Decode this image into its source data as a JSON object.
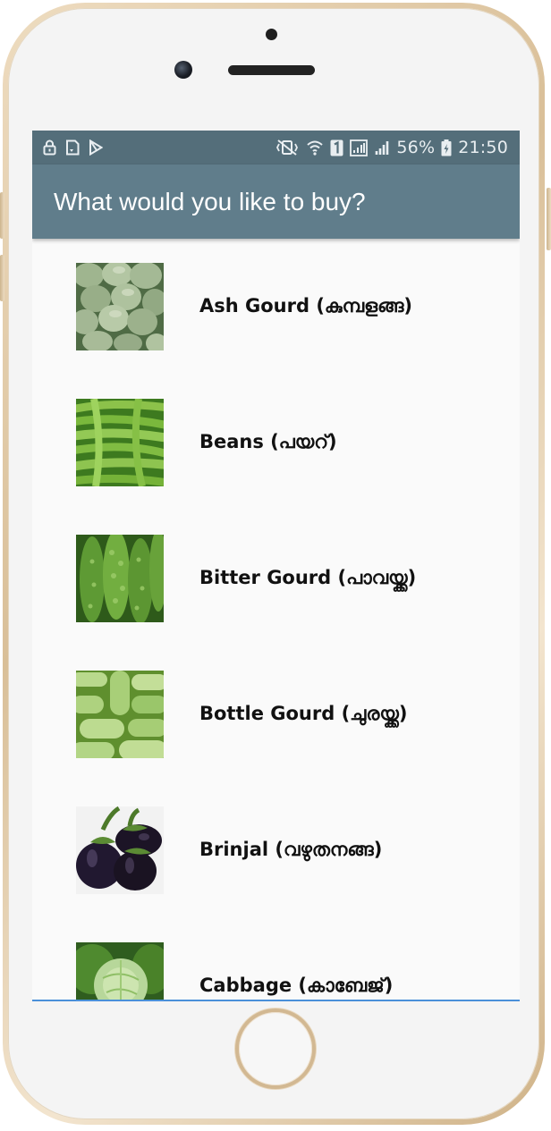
{
  "status_bar": {
    "battery_percent": "56%",
    "time": "21:50",
    "left_icons": [
      "lock-icon",
      "sim-card-icon",
      "play-store-icon"
    ],
    "right_icons": [
      "vibrate-mute-icon",
      "wifi-icon",
      "sim1-badge-icon",
      "signal-icon",
      "signal-icon",
      "battery-charging-icon"
    ]
  },
  "app_bar": {
    "title": "What would you like to buy?",
    "color": "#607d8b"
  },
  "items": [
    {
      "label": "Ash Gourd (കുമ്പളങ്ങ)",
      "image": "ash-gourd-image"
    },
    {
      "label": "Beans (പയറ്)",
      "image": "beans-image"
    },
    {
      "label": "Bitter Gourd (പാവയ്ക്ക)",
      "image": "bitter-gourd-image"
    },
    {
      "label": "Bottle Gourd (ചുരയ്ക്ക)",
      "image": "bottle-gourd-image"
    },
    {
      "label": "Brinjal (വഴുതനങ്ങ)",
      "image": "brinjal-image"
    },
    {
      "label": "Cabbage (കാബേജ്)",
      "image": "cabbage-image"
    }
  ]
}
